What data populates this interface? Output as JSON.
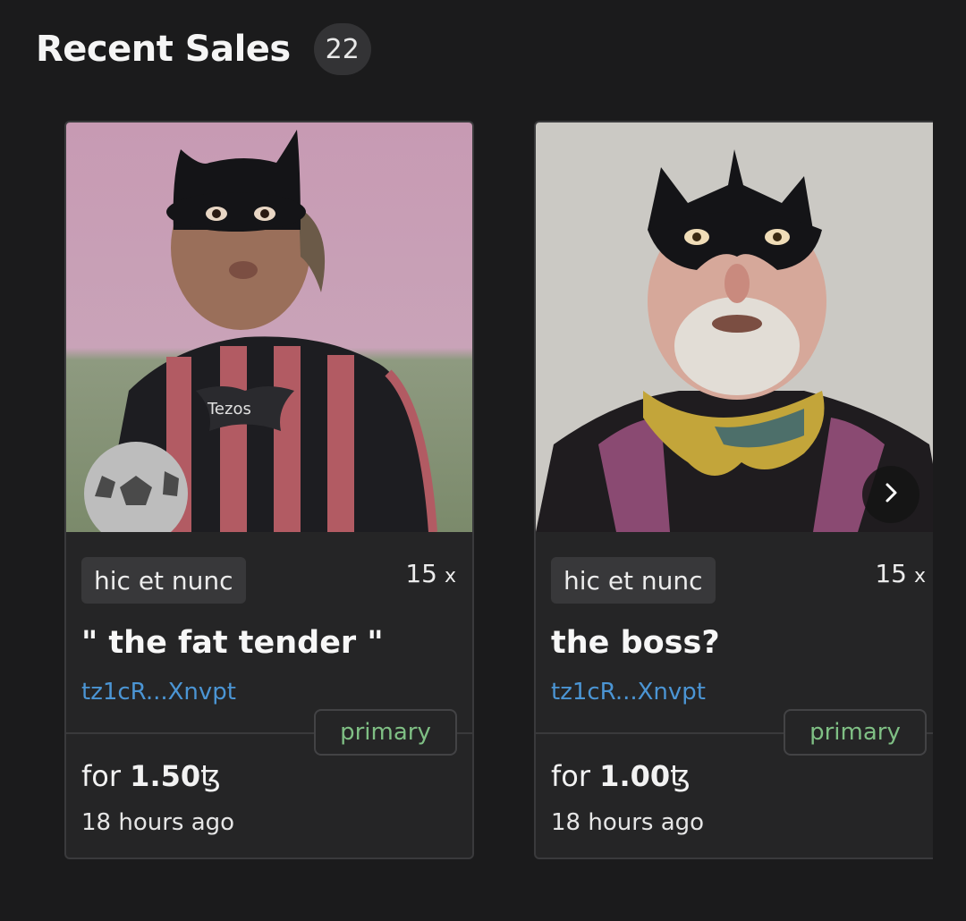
{
  "header": {
    "title": "Recent Sales",
    "count": "22"
  },
  "cards": [
    {
      "platform": "hic et nunc",
      "editions": "15",
      "editions_suffix": "x",
      "name": "\" the fat tender \"",
      "creator": "tz1cR...Xnvpt",
      "sale_type": "primary",
      "price_prefix": "for",
      "price": "1.50",
      "currency_symbol": "ꜩ",
      "time": "18 hours ago",
      "art_text": "Tezos"
    },
    {
      "platform": "hic et nunc",
      "editions": "15",
      "editions_suffix": "x",
      "name": "the boss?",
      "creator": "tz1cR...Xnvpt",
      "sale_type": "primary",
      "price_prefix": "for",
      "price": "1.00",
      "currency_symbol": "ꜩ",
      "time": "18 hours ago"
    }
  ],
  "icons": {
    "next": "chevron-right-icon"
  },
  "colors": {
    "link": "#4b95d4",
    "badge_text": "#7fbf84",
    "background": "#1b1b1c",
    "card": "#252526"
  }
}
